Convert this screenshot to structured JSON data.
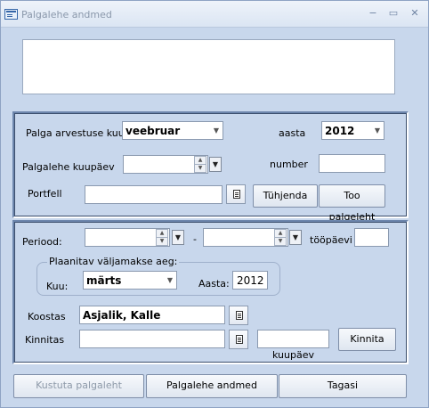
{
  "window": {
    "title": "Palgalehe andmed",
    "controls": {
      "minimize": "−",
      "restore": "▭",
      "close": "✕"
    }
  },
  "period": {
    "month_label": "Palga arvestuse kuu",
    "month_value": "veebruar",
    "year_label": "aasta",
    "year_value": "2012",
    "date_label": "Palgalehe kuupäev",
    "date_value": "",
    "number_label": "number",
    "number_value": "",
    "portfolio_label": "Portfell",
    "portfolio_value": "",
    "clear_button": "Tühjenda",
    "fetch_button": "Too palgeleht"
  },
  "details": {
    "period_label": "Periood:",
    "period_dash": "-",
    "period_start": "",
    "period_end": "",
    "workdays_label": "tööpäevi",
    "workdays_value": "",
    "payout_legend": "Plaanitav väljamakse aeg:",
    "payout_month_label": "Kuu:",
    "payout_month_value": "märts",
    "payout_year_label": "Aasta:",
    "payout_year_value": "2012",
    "compiled_label": "Koostas",
    "compiled_value": "Asjalik, Kalle",
    "approved_label": "Kinnitas",
    "approved_value": "",
    "approved_date_value": "",
    "approved_date_caption": "kuupäev",
    "approve_button": "Kinnita"
  },
  "footer": {
    "delete_button": "Kustuta palgaleht",
    "data_button": "Palgalehe andmed",
    "back_button": "Tagasi"
  },
  "colors": {
    "window_background": "#c8d7ec",
    "disabled_text": "#8e9aa9"
  }
}
